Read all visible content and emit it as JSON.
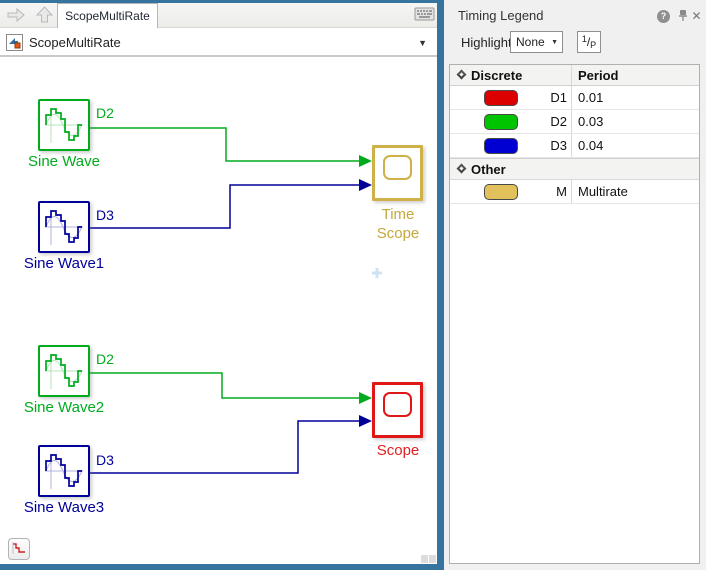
{
  "colors": {
    "frame": "#36739f"
  },
  "editor": {
    "tab": "ScopeMultiRate",
    "breadcrumb": "ScopeMultiRate",
    "blocks": {
      "sources": [
        {
          "label": "Sine Wave",
          "rate": "D2",
          "color": "#00ac1e"
        },
        {
          "label": "Sine Wave1",
          "rate": "D3",
          "color": "#000099"
        },
        {
          "label": "Sine Wave2",
          "rate": "D2",
          "color": "#00ac1e"
        },
        {
          "label": "Sine Wave3",
          "rate": "D3",
          "color": "#000099"
        }
      ],
      "sinks": [
        {
          "label": "Time Scope",
          "color": "#cfb14a",
          "label_color": "#c3a83c"
        },
        {
          "label": "Scope",
          "color": "#e01717",
          "label_color": "#e02020"
        }
      ]
    }
  },
  "legend": {
    "title": "Timing Legend",
    "highlight_label": "Highlight",
    "highlight_value": "None",
    "rate_button": {
      "numerator": "1",
      "slash": "/",
      "denominator": "P"
    },
    "table": {
      "period_header": "Period",
      "sections": [
        {
          "label": "Discrete",
          "rows": [
            {
              "label": "D1",
              "period": "0.01",
              "color": "#dd0000"
            },
            {
              "label": "D2",
              "period": "0.03",
              "color": "#00c400"
            },
            {
              "label": "D3",
              "period": "0.04",
              "color": "#0000d2"
            }
          ]
        },
        {
          "label": "Other",
          "rows": [
            {
              "label": "M",
              "period": "Multirate",
              "color": "#e2c05c"
            }
          ]
        }
      ]
    }
  },
  "icons": {
    "caret": "▼",
    "close": "✕",
    "help": "?"
  }
}
